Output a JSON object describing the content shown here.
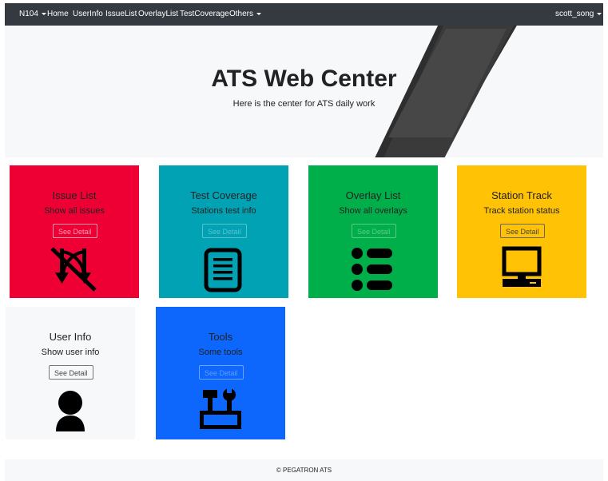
{
  "navbar": {
    "brand": "N104",
    "links": [
      "Home",
      "UserInfo",
      "IssueList",
      "OverlayList",
      "TestCoverage"
    ],
    "others": "Others",
    "user": "scott_song"
  },
  "hero": {
    "title": "ATS Web Center",
    "subtitle": "Here is the center for ATS daily work"
  },
  "cards": [
    {
      "title": "Issue List",
      "subtitle": "Show all issues",
      "button": "See Detail",
      "icon": "no-plug-icon",
      "color": "#ee0035"
    },
    {
      "title": "Test Coverage",
      "subtitle": "Stations test info",
      "button": "See Detail",
      "icon": "document-list-icon",
      "color": "#00a2b4"
    },
    {
      "title": "Overlay List",
      "subtitle": "Show all overlays",
      "button": "See Detail",
      "icon": "bullet-list-icon",
      "color": "#00ae4a"
    },
    {
      "title": "Station Track",
      "subtitle": "Track station status",
      "button": "See Detail",
      "icon": "computer-icon",
      "color": "#ffc205"
    },
    {
      "title": "User Info",
      "subtitle": "Show user info",
      "button": "See Detail",
      "icon": "user-icon",
      "color": "#f7f8fa"
    },
    {
      "title": "Tools",
      "subtitle": "Some tools",
      "button": "See Detail",
      "icon": "toolbox-icon",
      "color": "#0d67fc"
    }
  ],
  "footer": {
    "text": "© PEGATRON ATS"
  }
}
